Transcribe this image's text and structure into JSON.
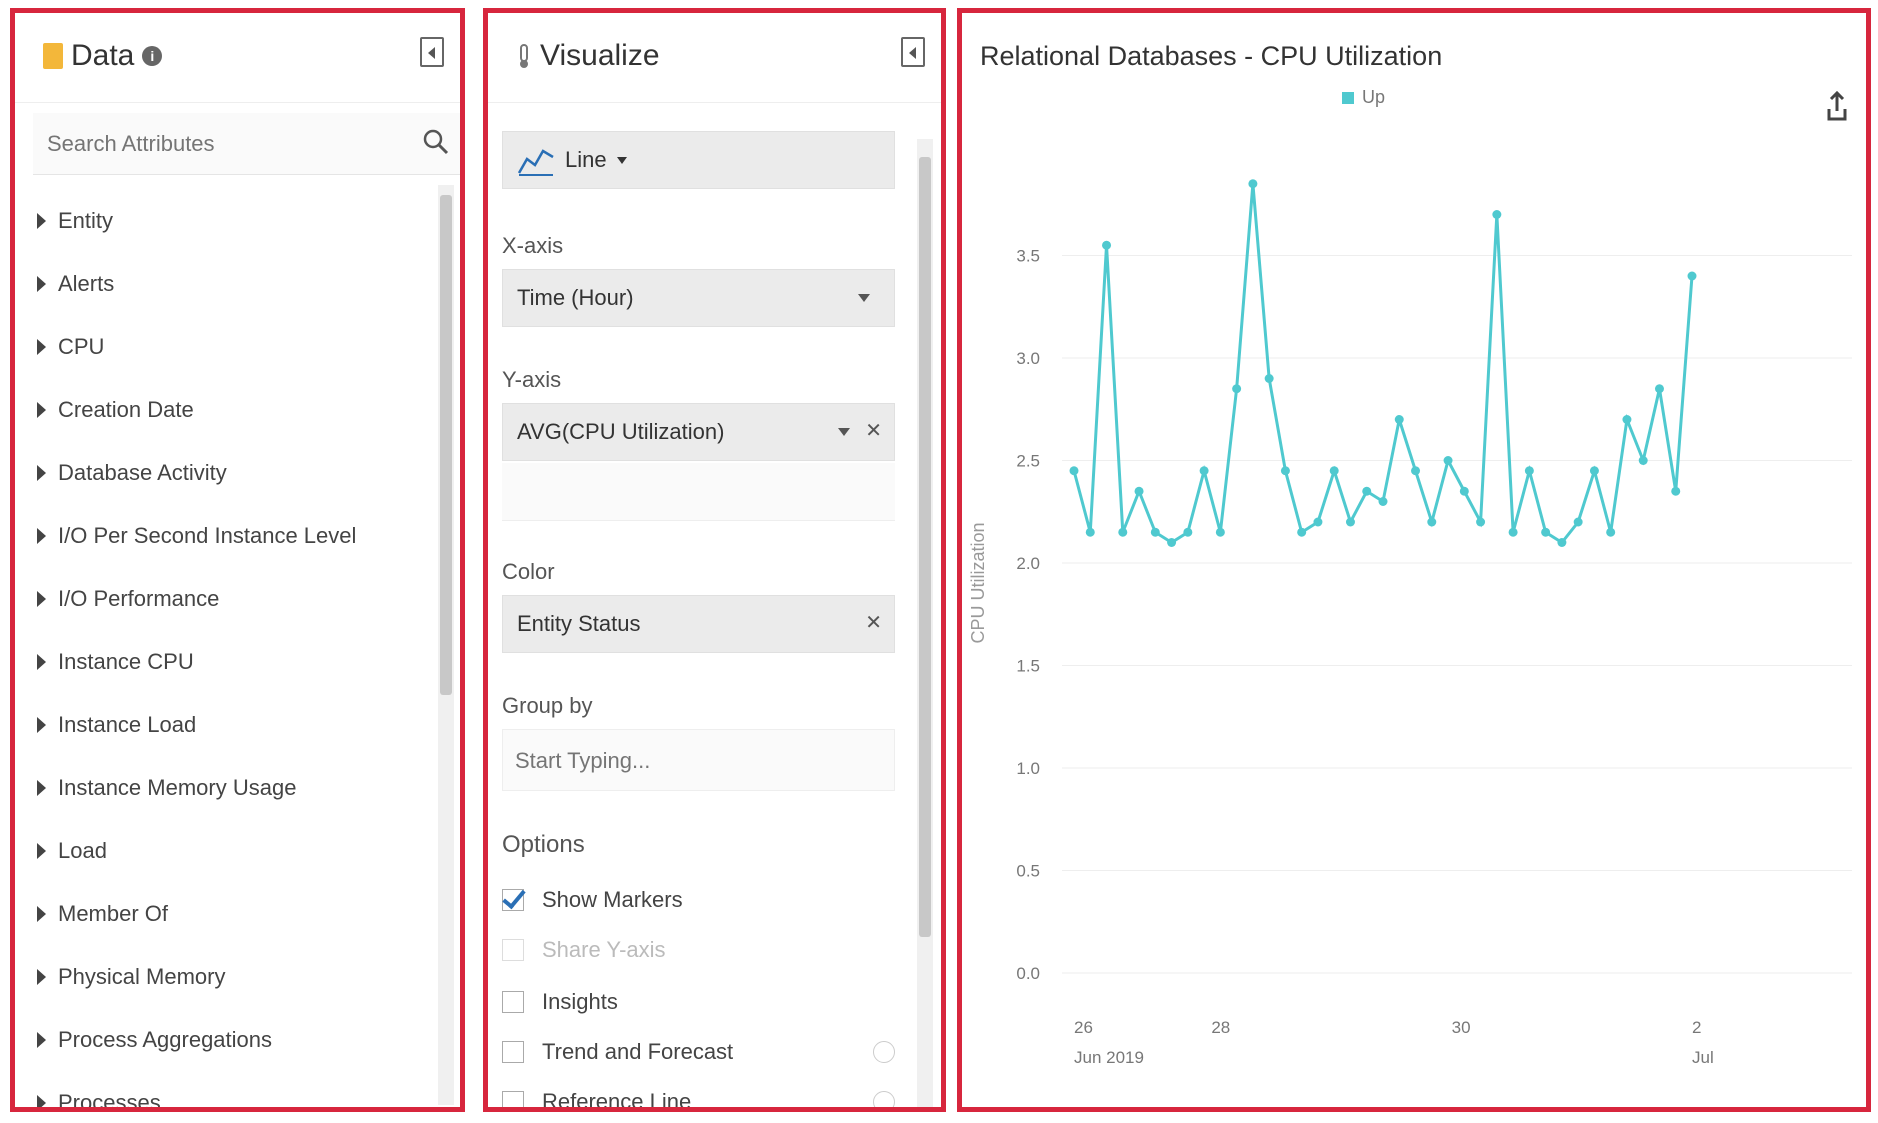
{
  "data_panel": {
    "title": "Data",
    "search_placeholder": "Search Attributes",
    "attributes": [
      "Entity",
      "Alerts",
      "CPU",
      "Creation Date",
      "Database Activity",
      "I/O Per Second Instance Level",
      "I/O Performance",
      "Instance CPU",
      "Instance Load",
      "Instance Memory Usage",
      "Load",
      "Member Of",
      "Physical Memory",
      "Process Aggregations",
      "Processes"
    ]
  },
  "viz_panel": {
    "title": "Visualize",
    "chart_type": "Line",
    "xaxis_label": "X-axis",
    "xaxis_value": "Time (Hour)",
    "yaxis_label": "Y-axis",
    "yaxis_value": "AVG(CPU Utilization)",
    "color_label": "Color",
    "color_value": "Entity Status",
    "groupby_label": "Group by",
    "groupby_placeholder": "Start Typing...",
    "options_title": "Options",
    "options": [
      {
        "label": "Show Markers",
        "checked": true,
        "disabled": false
      },
      {
        "label": "Share Y-axis",
        "checked": false,
        "disabled": true
      },
      {
        "label": "Insights",
        "checked": false,
        "disabled": false
      },
      {
        "label": "Trend and Forecast",
        "checked": false,
        "disabled": false
      },
      {
        "label": "Reference Line",
        "checked": false,
        "disabled": false
      }
    ]
  },
  "colors": {
    "panel_border": "#d7263d",
    "series": "#4fc9cf"
  },
  "chart_data": {
    "type": "line",
    "title": "Relational Databases - CPU Utilization",
    "ylabel": "CPU Utilization",
    "xlabel": "",
    "ylim": [
      0,
      4.0
    ],
    "yticks": [
      "0.0",
      "0.5",
      "1.0",
      "1.5",
      "2.0",
      "2.5",
      "3.0",
      "3.5"
    ],
    "xticks": [
      {
        "label": "26",
        "sublabel": "Jun 2019",
        "x": 0
      },
      {
        "label": "28",
        "sublabel": "",
        "x": 4
      },
      {
        "label": "30",
        "sublabel": "",
        "x": 11
      },
      {
        "label": "2",
        "sublabel": "Jul",
        "x": 18
      }
    ],
    "grid": true,
    "legend_position": "top-center",
    "series": [
      {
        "name": "Up",
        "values": [
          2.45,
          2.15,
          3.55,
          2.15,
          2.35,
          2.15,
          2.1,
          2.15,
          2.45,
          2.15,
          2.85,
          3.85,
          2.9,
          2.45,
          2.15,
          2.2,
          2.45,
          2.2,
          2.35,
          2.3,
          2.7,
          2.45,
          2.2,
          2.5,
          2.35,
          2.2,
          3.7,
          2.15,
          2.45,
          2.15,
          2.1,
          2.2,
          2.45,
          2.15,
          2.7,
          2.5,
          2.85,
          2.35,
          3.4
        ]
      }
    ]
  }
}
